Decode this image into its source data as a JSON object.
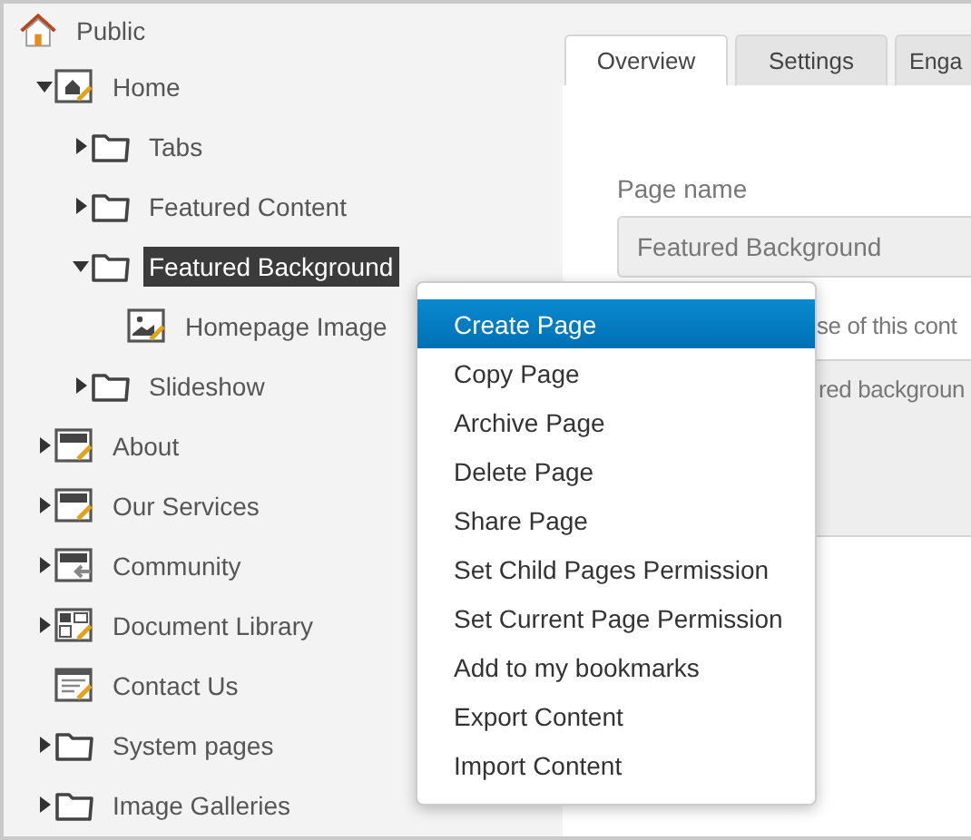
{
  "tree": {
    "label": "Public",
    "kind": "root",
    "selected": false,
    "children": [
      {
        "label": "Home",
        "kind": "home",
        "expanded": true,
        "selected": false,
        "children": [
          {
            "label": "Tabs",
            "kind": "folder",
            "expanded": false,
            "selected": false
          },
          {
            "label": "Featured Content",
            "kind": "folder",
            "expanded": false,
            "selected": false
          },
          {
            "label": "Featured Background",
            "kind": "folder",
            "expanded": true,
            "selected": true,
            "children": [
              {
                "label": "Homepage Image",
                "kind": "image",
                "selected": false
              }
            ]
          },
          {
            "label": "Slideshow",
            "kind": "folder",
            "expanded": false,
            "selected": false
          }
        ]
      },
      {
        "label": "About",
        "kind": "page",
        "expanded": false,
        "selected": false
      },
      {
        "label": "Our Services",
        "kind": "page",
        "expanded": false,
        "selected": false
      },
      {
        "label": "Community",
        "kind": "link",
        "expanded": false,
        "selected": false
      },
      {
        "label": "Document Library",
        "kind": "grid",
        "expanded": false,
        "selected": false
      },
      {
        "label": "Contact Us",
        "kind": "form",
        "selected": false
      },
      {
        "label": "System pages",
        "kind": "folder",
        "expanded": false,
        "selected": false
      },
      {
        "label": "Image Galleries",
        "kind": "folder",
        "expanded": false,
        "selected": false
      }
    ]
  },
  "tabs": [
    {
      "label": "Overview",
      "selected": true
    },
    {
      "label": "Settings",
      "selected": false
    },
    {
      "label": "Enga",
      "selected": false
    }
  ],
  "form": {
    "page_name_label": "Page name",
    "page_name_value": "Featured Background",
    "description_label": "se of this cont",
    "description_value": "red backgroun"
  },
  "context_menu": [
    {
      "label": "Create Page",
      "selected": true
    },
    {
      "label": "Copy Page",
      "selected": false
    },
    {
      "label": "Archive Page",
      "selected": false
    },
    {
      "label": "Delete Page",
      "selected": false
    },
    {
      "label": "Share Page",
      "selected": false
    },
    {
      "label": "Set Child Pages Permission",
      "selected": false
    },
    {
      "label": "Set Current Page Permission",
      "selected": false
    },
    {
      "label": "Add to my bookmarks",
      "selected": false
    },
    {
      "label": "Export Content",
      "selected": false
    },
    {
      "label": "Import Content",
      "selected": false
    }
  ]
}
